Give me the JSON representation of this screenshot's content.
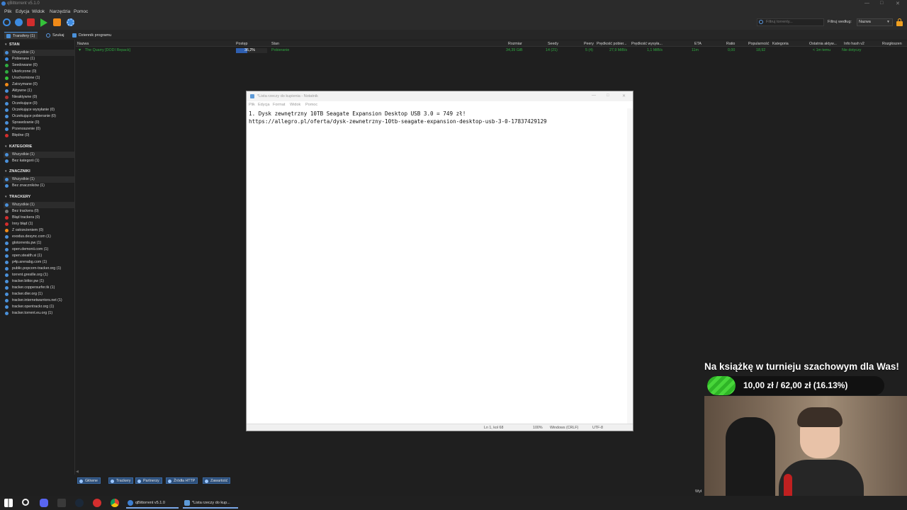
{
  "window": {
    "title": "qBittorrent v5.1.0"
  },
  "menu": [
    "Plik",
    "Edycja",
    "Widok",
    "Narzędzia",
    "Pomoc"
  ],
  "toolbar": {
    "filter_placeholder": "Filtruj torrenty...",
    "filter_by_label": "Filtruj według:",
    "filter_by_value": "Nazwa"
  },
  "tabs": [
    "Transfery (1)",
    "Szukaj",
    "Dziennik programu"
  ],
  "sidebar": {
    "status": {
      "header": "STAN",
      "items": [
        "Wszystkie (1)",
        "Pobierane (1)",
        "Seedowane (0)",
        "Ukończone (0)",
        "Uruchomione (1)",
        "Zatrzymane (0)",
        "Aktywne (1)",
        "Nieaktywne (0)",
        "Oczekujące (0)",
        "Oczekujące wysyłanie (0)",
        "Oczekujące pobieranie (0)",
        "Sprawdzanie (0)",
        "Przenoszenie (0)",
        "Błędne (0)"
      ]
    },
    "categories": {
      "header": "KATEGORIE",
      "items": [
        "Wszystkie (1)",
        "Bez kategorii (1)"
      ]
    },
    "tags": {
      "header": "ZNACZNIKI",
      "items": [
        "Wszystkie (1)",
        "Bez znaczników (1)"
      ]
    },
    "trackers": {
      "header": "TRACKERY",
      "items": [
        "Wszystkie (1)",
        "Bez trackera (0)",
        "Błąd trackera (0)",
        "Inny błąd (1)",
        "Z ostrzeżeniem (0)",
        "exodus.desync.com (1)",
        "glotorrents.pw (1)",
        "open.demonii.com (1)",
        "open.stealth.si (1)",
        "p4p.arenabg.com (1)",
        "public.popcorn-tracker.org (1)",
        "torrent.gresille.org (1)",
        "tracker.bittor.pw (1)",
        "tracker.coppersurfer.tk (1)",
        "tracker.dler.org (1)",
        "tracker.internetwarriors.net (1)",
        "tracker.opentrackr.org (1)",
        "tracker.torrent.eu.org (1)"
      ]
    }
  },
  "table": {
    "headers": [
      "Nazwa",
      "Postęp",
      "Stan",
      "Rozmiar",
      "Seedy",
      "Peery",
      "Prędkość pobier...",
      "Prędkość wysyła...",
      "ETA",
      "Ratio",
      "Popularność",
      "Kategoria",
      "Ostatnia aktyw...",
      "Info hash v2",
      "Rozgłoszen"
    ],
    "row": {
      "name": "The Quarry [DODI Repack]",
      "progress_text": "36,2%",
      "progress": 0.362,
      "state": "Pobieranie",
      "size": "34,39 GiB",
      "seeds": "14 (21)",
      "peers": "5 (4)",
      "down_speed": "27,9 MiB/s",
      "up_speed": "1,1 MiB/s",
      "eta": "11m",
      "ratio": "0,00",
      "popularity": "18,92",
      "last_activity": "< 1m temu",
      "info_hash_v2": "Nie dotyczy"
    }
  },
  "bottom_tabs": [
    "Główne",
    "Trackery",
    "Partnerzy",
    "Źródła HTTP",
    "Zawartość"
  ],
  "notepad": {
    "title": "*Lista rzeczy do kupienia - Notatnik",
    "menu": [
      "Plik",
      "Edycja",
      "Format",
      "Widok",
      "Pomoc"
    ],
    "line1": "1. Dysk zewnętrzny 10TB Seagate Expansion Desktop USB 3.0 = 749 zł!",
    "line2": "https://allegro.pl/oferta/dysk-zewnetrzny-10tb-seagate-expansion-desktop-usb-3-0-17837429129",
    "status": {
      "position": "Ln 1, kol 68",
      "zoom": "100%",
      "line_endings": "Windows (CRLF)",
      "encoding": "UTF-8"
    }
  },
  "overlay": {
    "title": "Na książkę w turnieju szachowym dla Was!",
    "goal_text": "10,00 zł / 62,00 zł (16.13%)",
    "goal_fraction": 0.1613
  },
  "statusbar": {
    "right_text": "Wył"
  },
  "taskbar": {
    "apps": [
      "qBittorrent v5.1.0",
      "*Lista rzeczy do kup..."
    ]
  },
  "colors": {
    "accent": "#4a90d9",
    "progress_fill": "#2f5fb0",
    "downloading_text": "#2faa40",
    "goal_fill": "#48d63a"
  }
}
